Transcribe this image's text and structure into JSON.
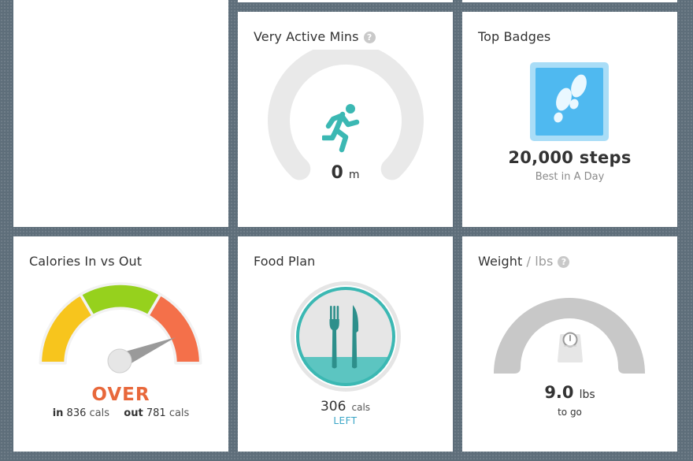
{
  "tiles": {
    "active": {
      "title": "Very Active Mins",
      "value": "0",
      "unit": "m",
      "help_icon": "question-icon",
      "icon": "running-person-icon",
      "progress": 0
    },
    "badges": {
      "title": "Top Badges",
      "value": "20,000 steps",
      "caption": "Best in A Day",
      "icon": "footprints-icon"
    },
    "calories": {
      "title": "Calories In vs Out",
      "status": "OVER",
      "in_label": "in",
      "in_value": "836",
      "in_unit": "cals",
      "out_label": "out",
      "out_value": "781",
      "out_unit": "cals"
    },
    "food": {
      "title": "Food Plan",
      "value": "306",
      "unit": "cals",
      "caption": "LEFT",
      "icon": "fork-knife-icon"
    },
    "weight": {
      "title": "Weight",
      "unit_title": " / lbs",
      "help_icon": "question-icon",
      "value": "9.0",
      "unit": "lbs",
      "caption": "to go",
      "icon": "scale-icon"
    }
  },
  "colors": {
    "background": "#5e6e7a",
    "teal": "#3bb8b3",
    "gauge_track": "#e9e9e9",
    "badge_blue": "#4fb9f0",
    "gauge_yellow": "#f7c51d",
    "gauge_green": "#96d11d",
    "gauge_red": "#f4704a",
    "over_text": "#e8683b",
    "left_text": "#3aa6c7",
    "weight_gauge": "#c8c8c8"
  }
}
